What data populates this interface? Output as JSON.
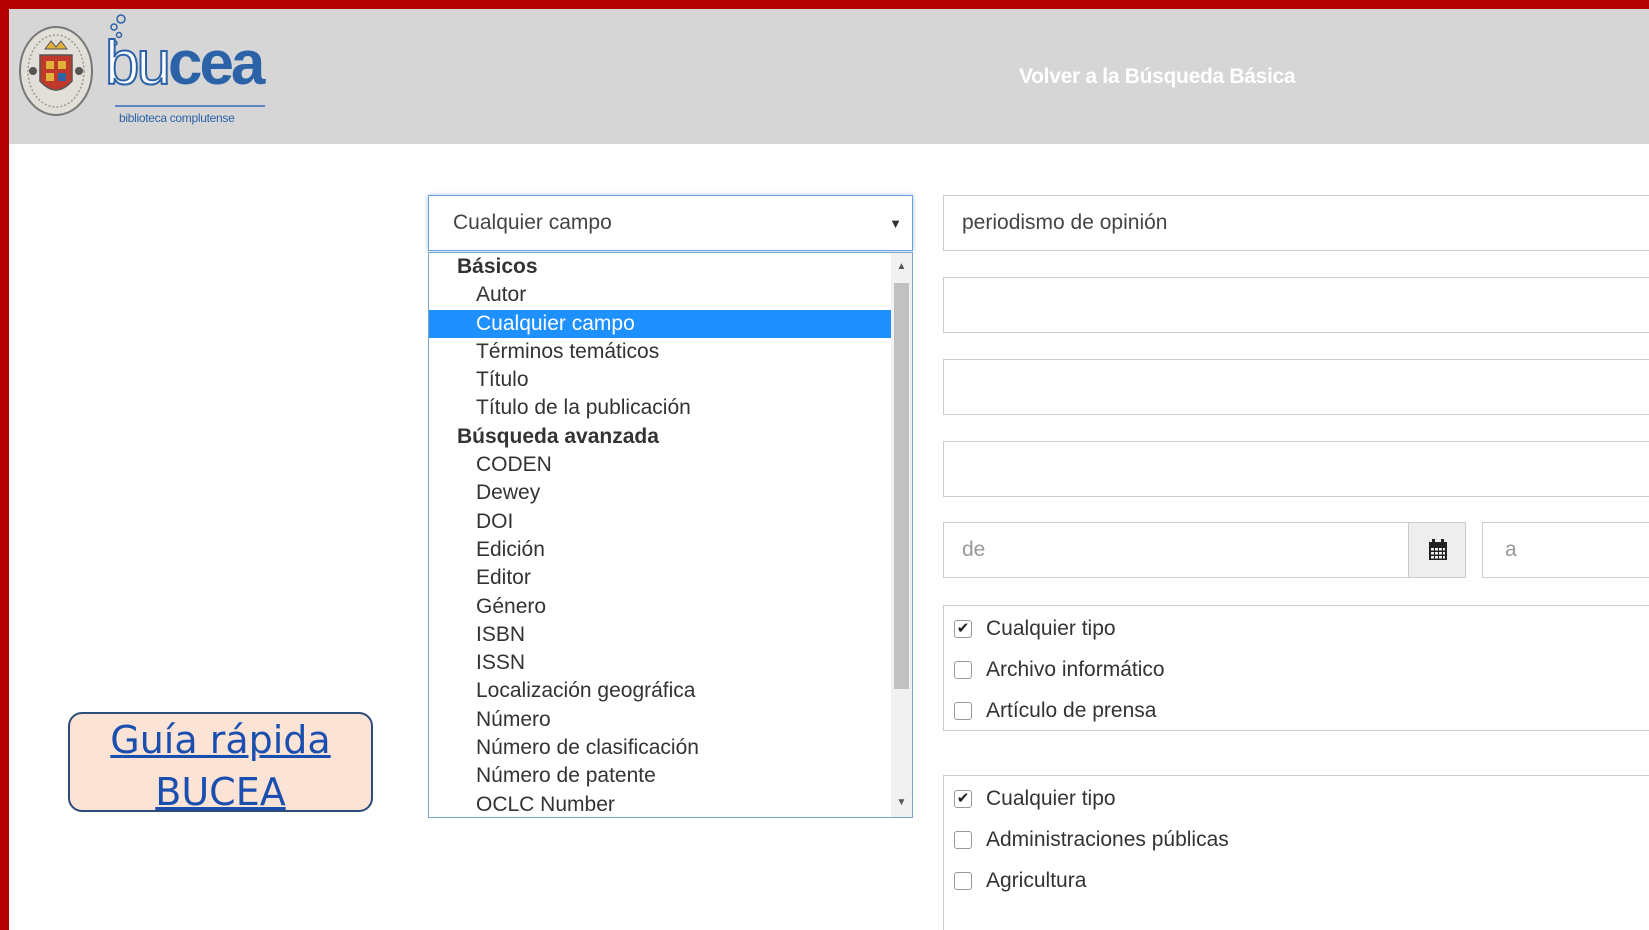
{
  "header": {
    "logo_text_thin": "bu",
    "logo_text_bold": "cea",
    "logo_subtitle": "biblioteca complutense",
    "back_link": "Volver a la Búsqueda Básica"
  },
  "search": {
    "field_select_value": "Cualquier campo",
    "query_value": "periodismo de opinión",
    "date_from_placeholder": "de",
    "date_to_placeholder": "a"
  },
  "dropdown": {
    "items": [
      {
        "label": "Básicos",
        "kind": "group"
      },
      {
        "label": "Autor",
        "kind": "opt"
      },
      {
        "label": "Cualquier campo",
        "kind": "opt",
        "selected": true
      },
      {
        "label": "Términos temáticos",
        "kind": "opt"
      },
      {
        "label": "Título",
        "kind": "opt"
      },
      {
        "label": "Título de la publicación",
        "kind": "opt"
      },
      {
        "label": "Búsqueda avanzada",
        "kind": "group"
      },
      {
        "label": "CODEN",
        "kind": "opt"
      },
      {
        "label": "Dewey",
        "kind": "opt"
      },
      {
        "label": "DOI",
        "kind": "opt"
      },
      {
        "label": "Edición",
        "kind": "opt"
      },
      {
        "label": "Editor",
        "kind": "opt"
      },
      {
        "label": "Género",
        "kind": "opt"
      },
      {
        "label": "ISBN",
        "kind": "opt"
      },
      {
        "label": "ISSN",
        "kind": "opt"
      },
      {
        "label": "Localización geográfica",
        "kind": "opt"
      },
      {
        "label": "Número",
        "kind": "opt"
      },
      {
        "label": "Número de clasificación",
        "kind": "opt"
      },
      {
        "label": "Número de patente",
        "kind": "opt"
      },
      {
        "label": "OCLC Number",
        "kind": "opt"
      }
    ]
  },
  "format_filter": {
    "items": [
      {
        "label": "Cualquier tipo",
        "checked": true
      },
      {
        "label": "Archivo informático",
        "checked": false
      },
      {
        "label": "Artículo de prensa",
        "checked": false
      }
    ]
  },
  "subject_filter": {
    "items": [
      {
        "label": "Cualquier tipo",
        "checked": true
      },
      {
        "label": "Administraciones públicas",
        "checked": false
      },
      {
        "label": "Agricultura",
        "checked": false
      }
    ]
  },
  "guide": {
    "line1": "Guía rápida",
    "line2": "BUCEA"
  },
  "colors": {
    "frame": "#b40000",
    "header_bg": "#d6d6d6",
    "brand": "#2c62a8",
    "selection": "#1e90ff",
    "guide_bg": "#fbe3d6"
  },
  "icons": {
    "crest": "university-crest-icon",
    "calendar": "calendar-icon"
  }
}
